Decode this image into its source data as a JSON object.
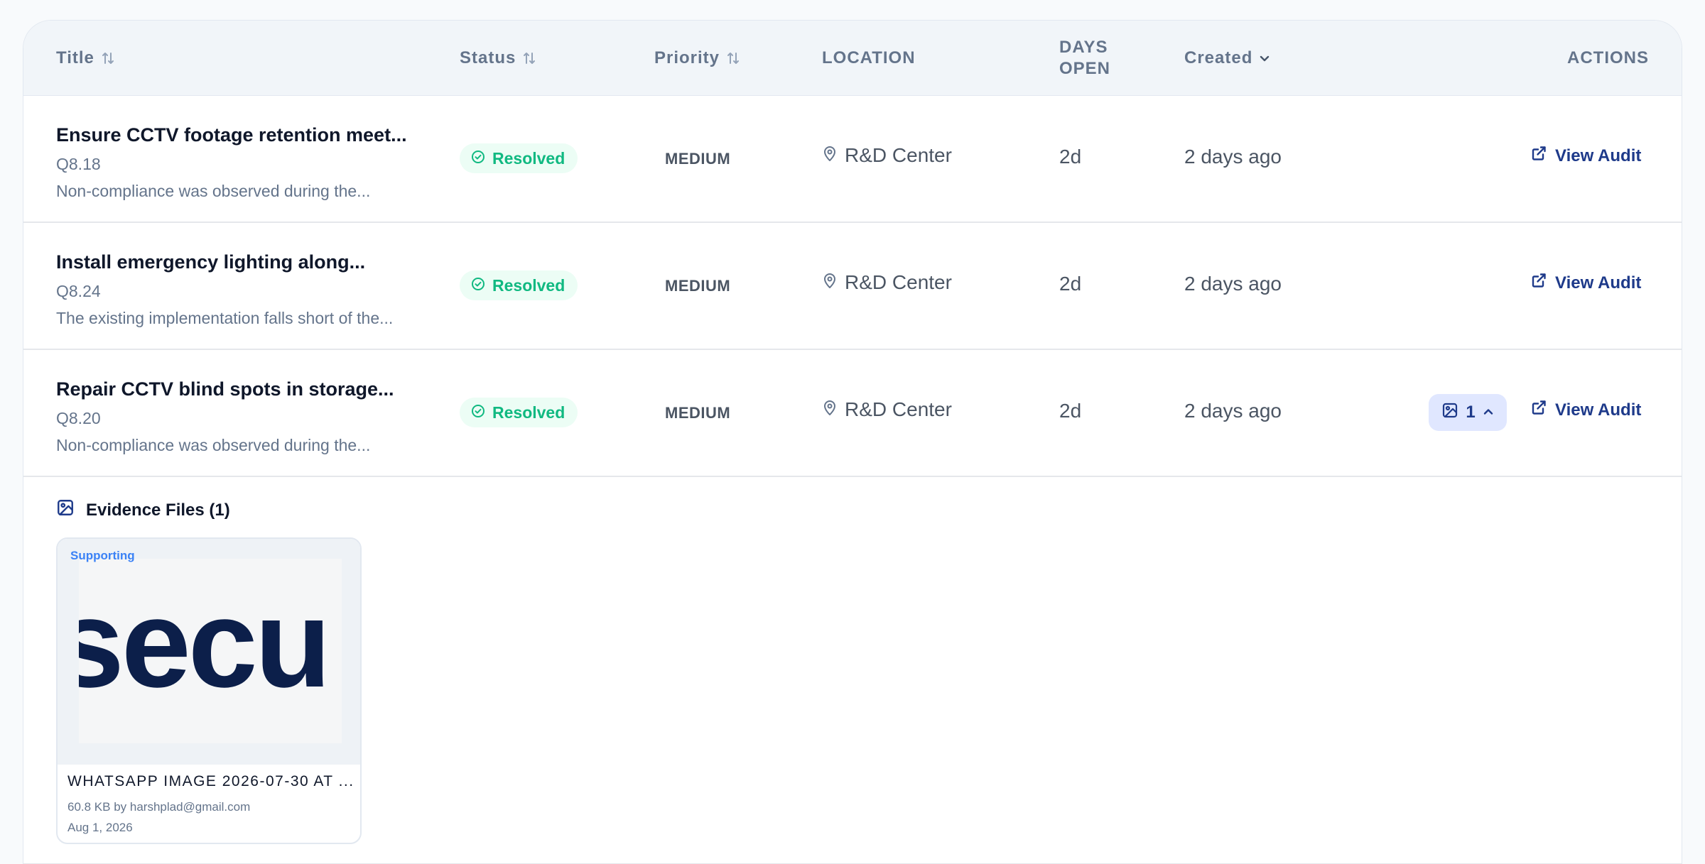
{
  "columns": {
    "title": "Title",
    "status": "Status",
    "priority": "Priority",
    "location": "LOCATION",
    "days_open_line1": "DAYS",
    "days_open_line2": "OPEN",
    "created": "Created",
    "actions": "ACTIONS"
  },
  "rows": [
    {
      "title": "Ensure CCTV footage retention meet...",
      "code": "Q8.18",
      "description": "Non-compliance was observed during the...",
      "status": "Resolved",
      "priority": "MEDIUM",
      "location": "R&D Center",
      "days_open": "2d",
      "created": "2 days ago",
      "action": "View Audit"
    },
    {
      "title": "Install emergency lighting along...",
      "code": "Q8.24",
      "description": "The existing implementation falls short of the...",
      "status": "Resolved",
      "priority": "MEDIUM",
      "location": "R&D Center",
      "days_open": "2d",
      "created": "2 days ago",
      "action": "View Audit"
    },
    {
      "title": "Repair CCTV blind spots in storage...",
      "code": "Q8.20",
      "description": "Non-compliance was observed during the...",
      "status": "Resolved",
      "priority": "MEDIUM",
      "location": "R&D Center",
      "days_open": "2d",
      "created": "2 days ago",
      "evidence_count": "1",
      "action": "View Audit"
    }
  ],
  "evidence": {
    "heading": "Evidence Files (1)",
    "files": [
      {
        "tag": "Supporting",
        "thumbnail_text": "secu",
        "name": "WHATSAPP IMAGE 2026-07-30 AT ...",
        "size_by": "60.8 KB  by harshplad@gmail.com",
        "date": "Aug 1, 2026"
      }
    ]
  },
  "colors": {
    "accent": "#1e3a8a",
    "resolved": "#10b981",
    "resolved_bg": "#ecfdf5",
    "header_bg": "#f1f5f9"
  },
  "icons": {
    "sort": "sort-arrows-icon",
    "chevron": "chevron-down-icon",
    "status": "check-circle-icon",
    "location": "map-pin-icon",
    "external": "external-link-icon",
    "image": "image-icon",
    "chevron_up": "chevron-up-icon"
  }
}
